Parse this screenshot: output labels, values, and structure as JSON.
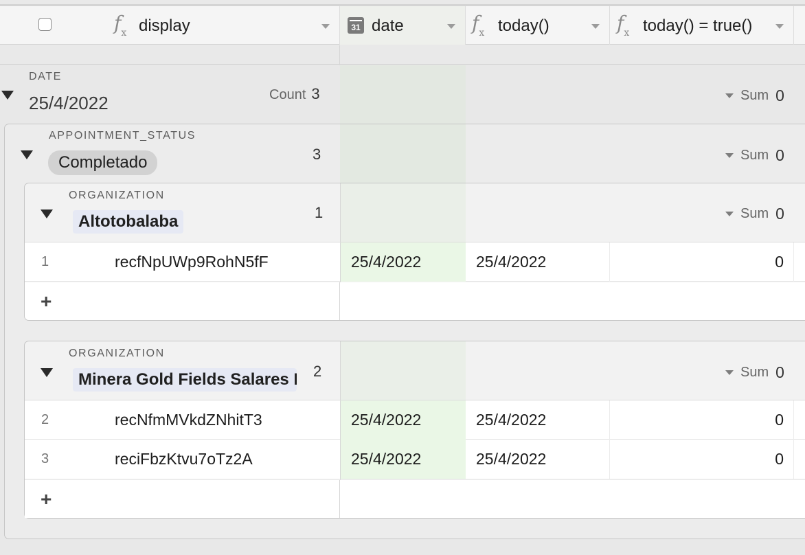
{
  "columns": [
    {
      "name": "display",
      "icon": "formula-icon"
    },
    {
      "name": "date",
      "icon": "calendar-icon"
    },
    {
      "name": "today()",
      "icon": "formula-icon"
    },
    {
      "name": "today() = true()",
      "icon": "formula-icon"
    }
  ],
  "calendar_icon_text": "31",
  "formula_icon_text": "f",
  "formula_icon_sub": "x",
  "group_date": {
    "label": "DATE",
    "value": "25/4/2022",
    "count_label": "Count",
    "count": "3",
    "sum_label": "Sum",
    "sum_value": "0"
  },
  "group_status": {
    "label": "APPOINTMENT_STATUS",
    "value": "Completado",
    "count": "3",
    "sum_label": "Sum",
    "sum_value": "0"
  },
  "org_groups": [
    {
      "label": "ORGANIZATION",
      "value": "Altotobalaba",
      "count": "1",
      "sum_label": "Sum",
      "sum_value": "0",
      "rows": [
        {
          "index": "1",
          "display": "recfNpUWp9RohN5fF",
          "date": "25/4/2022",
          "today": "25/4/2022",
          "today_true": "0"
        }
      ]
    },
    {
      "label": "ORGANIZATION",
      "value": "Minera Gold Fields Salares Norte",
      "count": "2",
      "sum_label": "Sum",
      "sum_value": "0",
      "rows": [
        {
          "index": "2",
          "display": "recNfmMVkdZNhitT3",
          "date": "25/4/2022",
          "today": "25/4/2022",
          "today_true": "0"
        },
        {
          "index": "3",
          "display": "reciFbzKtvu7oTz2A",
          "date": "25/4/2022",
          "today": "25/4/2022",
          "today_true": "0"
        }
      ]
    }
  ],
  "add_row_symbol": "+",
  "colors": {
    "date_band": "#e3e8e1",
    "date_cell": "#eaf7e6",
    "org_pill": "#e6e9f4",
    "status_pill": "#d2d2d2"
  }
}
